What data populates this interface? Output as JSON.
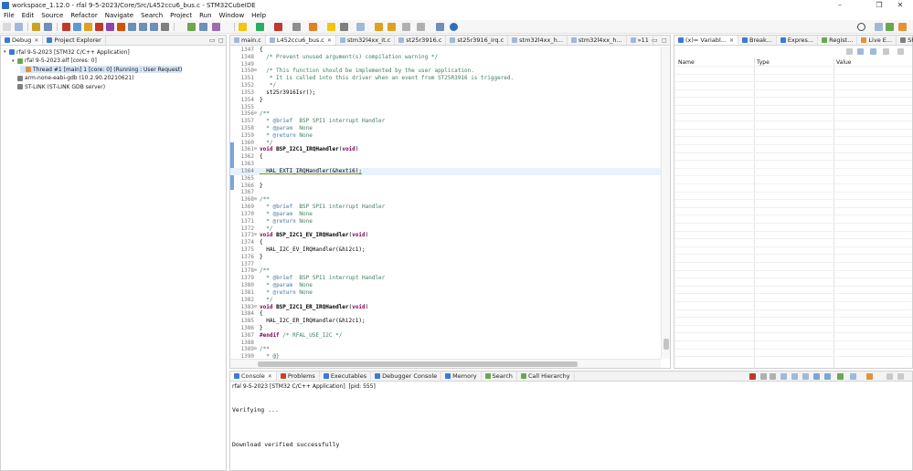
{
  "window": {
    "title": "workspace_1.12.0 - rfal 9-5-2023/Core/Src/L452ccu6_bus.c - STM32CubeIDE",
    "minimize": "–",
    "restore": "❐",
    "close": "✕"
  },
  "menu": [
    "File",
    "Edit",
    "Source",
    "Refactor",
    "Navigate",
    "Search",
    "Project",
    "Run",
    "Window",
    "Help"
  ],
  "debug_view": {
    "tabs": [
      {
        "label": "Debug",
        "closable": true
      },
      {
        "label": "Project Explorer",
        "closable": false
      }
    ],
    "tree": [
      {
        "label": "rfal 9-5-2023 [STM32 C/C++ Application]",
        "indent": 0,
        "twisty": "▾",
        "icon_color": "#3a7bd5"
      },
      {
        "label": "rfal 9-5-2023.elf [cores: 0]",
        "indent": 1,
        "twisty": "▾",
        "icon_color": "#6aa84f"
      },
      {
        "label": "Thread #1 [main] 1 [core: 0] (Running : User Request)",
        "indent": 2,
        "twisty": "",
        "icon_color": "#e69138",
        "selected": true
      },
      {
        "label": "arm-none-eabi-gdb (10.2.90.20210621)",
        "indent": 1,
        "twisty": "",
        "icon_color": "#7f7f7f"
      },
      {
        "label": "ST-LINK (ST-LINK GDB server)",
        "indent": 1,
        "twisty": "",
        "icon_color": "#7f7f7f"
      }
    ]
  },
  "editor": {
    "tabs": [
      {
        "label": "main.c",
        "active": false,
        "closable": false
      },
      {
        "label": "L452ccu6_bus.c",
        "active": true,
        "closable": true
      },
      {
        "label": "stm32l4xx_it.c",
        "active": false,
        "closable": false
      },
      {
        "label": "st25r3916.c",
        "active": false,
        "closable": false
      },
      {
        "label": "st25r3916_irq.c",
        "active": false,
        "closable": false
      },
      {
        "label": "stm32l4xx_h...",
        "active": false,
        "closable": false
      },
      {
        "label": "stm32l4xx_h...",
        "active": false,
        "closable": false
      },
      {
        "label": "»11",
        "active": false,
        "closable": false
      }
    ],
    "lines": [
      {
        "n": "1347",
        "fold": "",
        "parts": [
          [
            "t-plain",
            "{"
          ]
        ]
      },
      {
        "n": "1348",
        "fold": "",
        "parts": [
          [
            "t-cmt",
            "  /* Prevent unused argument(s) compilation warning */"
          ]
        ]
      },
      {
        "n": "1349",
        "fold": "",
        "parts": []
      },
      {
        "n": "1350",
        "fold": "⊖",
        "parts": [
          [
            "t-cmt",
            "  /* This function should be implemented by the user application."
          ]
        ]
      },
      {
        "n": "1351",
        "fold": "",
        "parts": [
          [
            "t-cmt",
            "   * It is called into this driver when an event from ST25R3916 is triggered."
          ]
        ]
      },
      {
        "n": "1352",
        "fold": "",
        "parts": [
          [
            "t-cmt",
            "   */"
          ]
        ]
      },
      {
        "n": "1353",
        "fold": "",
        "parts": [
          [
            "t-plain",
            "  st25r3916Isr();"
          ]
        ]
      },
      {
        "n": "1354",
        "fold": "",
        "parts": [
          [
            "t-plain",
            "}"
          ]
        ]
      },
      {
        "n": "1355",
        "fold": "",
        "parts": []
      },
      {
        "n": "1356",
        "fold": "⊖",
        "parts": [
          [
            "t-cmt",
            "/**"
          ]
        ]
      },
      {
        "n": "1357",
        "fold": "",
        "parts": [
          [
            "t-cmt",
            "  * "
          ],
          [
            "t-tag",
            "@brief"
          ],
          [
            "t-cmt",
            "  BSP SPI1 interrupt Handler"
          ]
        ]
      },
      {
        "n": "1358",
        "fold": "",
        "parts": [
          [
            "t-cmt",
            "  * "
          ],
          [
            "t-tag",
            "@param"
          ],
          [
            "t-cmt",
            "  None"
          ]
        ]
      },
      {
        "n": "1359",
        "fold": "",
        "parts": [
          [
            "t-cmt",
            "  * "
          ],
          [
            "t-tag",
            "@return"
          ],
          [
            "t-cmt",
            " None"
          ]
        ]
      },
      {
        "n": "1360",
        "fold": "",
        "parts": [
          [
            "t-cmt",
            "  */"
          ]
        ]
      },
      {
        "n": "1361",
        "fold": "⊖",
        "parts": [
          [
            "t-kw",
            "void "
          ],
          [
            "t-fn",
            "BSP_I2C1_IRQHandler"
          ],
          [
            "t-plain",
            "("
          ],
          [
            "t-kw",
            "void"
          ],
          [
            "t-plain",
            ")"
          ]
        ]
      },
      {
        "n": "1362",
        "fold": "",
        "parts": [
          [
            "t-plain",
            "{"
          ]
        ]
      },
      {
        "n": "1363",
        "fold": "",
        "parts": []
      },
      {
        "n": "1364",
        "fold": "",
        "current": true,
        "parts": [
          [
            "t-ul",
            "  HAL_EXTI_IRQHandler(&hexti6);"
          ]
        ]
      },
      {
        "n": "1365",
        "fold": "",
        "parts": []
      },
      {
        "n": "1366",
        "fold": "",
        "parts": [
          [
            "t-plain",
            "}"
          ]
        ]
      },
      {
        "n": "1367",
        "fold": "",
        "parts": []
      },
      {
        "n": "1368",
        "fold": "⊖",
        "parts": [
          [
            "t-cmt",
            "/**"
          ]
        ]
      },
      {
        "n": "1369",
        "fold": "",
        "parts": [
          [
            "t-cmt",
            "  * "
          ],
          [
            "t-tag",
            "@brief"
          ],
          [
            "t-cmt",
            "  BSP SPI1 interrupt Handler"
          ]
        ]
      },
      {
        "n": "1370",
        "fold": "",
        "parts": [
          [
            "t-cmt",
            "  * "
          ],
          [
            "t-tag",
            "@param"
          ],
          [
            "t-cmt",
            "  None"
          ]
        ]
      },
      {
        "n": "1371",
        "fold": "",
        "parts": [
          [
            "t-cmt",
            "  * "
          ],
          [
            "t-tag",
            "@return"
          ],
          [
            "t-cmt",
            " None"
          ]
        ]
      },
      {
        "n": "1372",
        "fold": "",
        "parts": [
          [
            "t-cmt",
            "  */"
          ]
        ]
      },
      {
        "n": "1373",
        "fold": "⊖",
        "parts": [
          [
            "t-kw",
            "void "
          ],
          [
            "t-fn",
            "BSP_I2C1_EV_IRQHandler"
          ],
          [
            "t-plain",
            "("
          ],
          [
            "t-kw",
            "void"
          ],
          [
            "t-plain",
            ")"
          ]
        ]
      },
      {
        "n": "1374",
        "fold": "",
        "parts": [
          [
            "t-plain",
            "{"
          ]
        ]
      },
      {
        "n": "1375",
        "fold": "",
        "parts": [
          [
            "t-plain",
            "  HAL_I2C_EV_IRQHandler(&hi2c1);"
          ]
        ]
      },
      {
        "n": "1376",
        "fold": "",
        "parts": [
          [
            "t-plain",
            "}"
          ]
        ]
      },
      {
        "n": "1377",
        "fold": "",
        "parts": []
      },
      {
        "n": "1378",
        "fold": "⊖",
        "parts": [
          [
            "t-cmt",
            "/**"
          ]
        ]
      },
      {
        "n": "1379",
        "fold": "",
        "parts": [
          [
            "t-cmt",
            "  * "
          ],
          [
            "t-tag",
            "@brief"
          ],
          [
            "t-cmt",
            "  BSP SPI1 interrupt Handler"
          ]
        ]
      },
      {
        "n": "1380",
        "fold": "",
        "parts": [
          [
            "t-cmt",
            "  * "
          ],
          [
            "t-tag",
            "@param"
          ],
          [
            "t-cmt",
            "  None"
          ]
        ]
      },
      {
        "n": "1381",
        "fold": "",
        "parts": [
          [
            "t-cmt",
            "  * "
          ],
          [
            "t-tag",
            "@return"
          ],
          [
            "t-cmt",
            " None"
          ]
        ]
      },
      {
        "n": "1382",
        "fold": "",
        "parts": [
          [
            "t-cmt",
            "  */"
          ]
        ]
      },
      {
        "n": "1383",
        "fold": "⊖",
        "parts": [
          [
            "t-kw",
            "void "
          ],
          [
            "t-fn",
            "BSP_I2C1_ER_IRQHandler"
          ],
          [
            "t-plain",
            "("
          ],
          [
            "t-kw",
            "void"
          ],
          [
            "t-plain",
            ")"
          ]
        ]
      },
      {
        "n": "1384",
        "fold": "",
        "parts": [
          [
            "t-plain",
            "{"
          ]
        ]
      },
      {
        "n": "1385",
        "fold": "",
        "parts": [
          [
            "t-plain",
            "  HAL_I2C_ER_IRQHandler(&hi2c1);"
          ]
        ]
      },
      {
        "n": "1386",
        "fold": "",
        "parts": [
          [
            "t-plain",
            "}"
          ]
        ]
      },
      {
        "n": "1387",
        "fold": "",
        "parts": [
          [
            "t-pp",
            "#endif "
          ],
          [
            "t-cmt",
            "/* RFAL_USE_I2C */"
          ]
        ]
      },
      {
        "n": "1388",
        "fold": "",
        "parts": []
      },
      {
        "n": "1389",
        "fold": "⊖",
        "parts": [
          [
            "t-cmt",
            "/**"
          ]
        ]
      },
      {
        "n": "1390",
        "fold": "",
        "parts": [
          [
            "t-cmt",
            "  * @}"
          ]
        ]
      }
    ]
  },
  "right_view": {
    "tabs": [
      {
        "label": "(x)= Variabl...",
        "icon_color": "#3a7bd5",
        "closable": true
      },
      {
        "label": "Break...",
        "icon_color": "#3a7bd5"
      },
      {
        "label": "Expres...",
        "icon_color": "#3a7bd5"
      },
      {
        "label": "Regist...",
        "icon_color": "#6aa84f"
      },
      {
        "label": "Live E...",
        "icon_color": "#e69138"
      },
      {
        "label": "SFRs",
        "icon_color": "#7f7f7f"
      }
    ],
    "columns": [
      "Name",
      "Type",
      "Value"
    ]
  },
  "console": {
    "tabs": [
      {
        "label": "Console",
        "icon_color": "#3a7bd5",
        "active": true,
        "closable": true
      },
      {
        "label": "Problems",
        "icon_color": "#cc4125"
      },
      {
        "label": "Executables",
        "icon_color": "#3a7bd5"
      },
      {
        "label": "Debugger Console",
        "icon_color": "#3a7bd5"
      },
      {
        "label": "Memory",
        "icon_color": "#3a7bd5"
      },
      {
        "label": "Search",
        "icon_color": "#6aa84f"
      },
      {
        "label": "Call Hierarchy",
        "icon_color": "#6aa84f"
      }
    ],
    "header": "rfal 9-5-2023 [STM32 C/C++ Application]  [pid: 555]",
    "lines": [
      "Verifying ...",
      "Download verified successfully"
    ]
  },
  "colors": {
    "accent": "#2d6fbd",
    "selection": "#d8e6f7",
    "current_line": "#e8f2fe",
    "comment": "#3f7f5f",
    "keyword": "#7f0055"
  }
}
